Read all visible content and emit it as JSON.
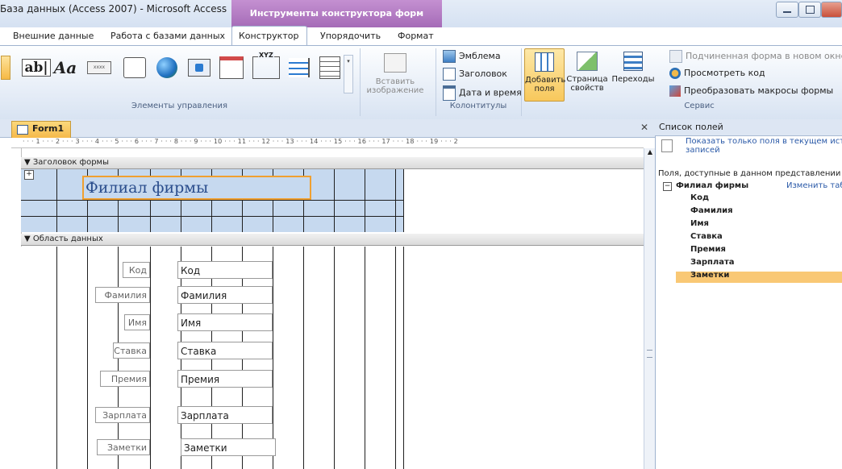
{
  "window": {
    "title": "База данных (Access 2007)  -  Microsoft Access",
    "context_tab_title": "Инструменты конструктора форм"
  },
  "tabs": [
    "Внешние данные",
    "Работа с базами данных",
    "Конструктор",
    "Упорядочить",
    "Формат"
  ],
  "ribbon": {
    "controls_group_label": "Элементы управления",
    "insert_image": [
      "Вставить",
      "изображение"
    ],
    "header_footer": {
      "label": "Колонтитулы",
      "items": [
        "Эмблема",
        "Заголовок",
        "Дата и время"
      ]
    },
    "add_fields": [
      "Добавить",
      "поля"
    ],
    "property_sheet": [
      "Страница",
      "свойств"
    ],
    "transitions": "Переходы",
    "service": {
      "label": "Сервис",
      "items": [
        "Подчиненная форма в новом окне",
        "Просмотреть код",
        "Преобразовать макросы формы"
      ]
    },
    "label_sample": "Aa",
    "textbox_sample": "ab|",
    "xyz": "XYZ"
  },
  "document": {
    "tab_label": "Form1",
    "header_bar": "Заголовок формы",
    "detail_bar": "Область данных",
    "form_title": "Филиал фирмы",
    "fields": [
      {
        "label": "Код",
        "value": "Код"
      },
      {
        "label": "Фамилия",
        "value": "Фамилия"
      },
      {
        "label": "Имя",
        "value": "Имя"
      },
      {
        "label": "Ставка",
        "value": "Ставка"
      },
      {
        "label": "Премия",
        "value": "Премия"
      },
      {
        "label": "Зарплата",
        "value": "Зарплата"
      },
      {
        "label": "Заметки",
        "value": "Заметки"
      }
    ],
    "ruler_marks": "· · · 1 · · · 2 · · · 3 · · · 4 · · · 5 · · · 6 · · · 7 · · · 8 · · · 9 · · · 10 · · · 11 · · · 12 · · · 13 · · · 14 · · · 15 · · · 16 · · · 17 · · · 18 · · · 19 · · · 2"
  },
  "field_list": {
    "title": "Список полей",
    "show_only": [
      "Показать только поля в текущем исто",
      "записей"
    ],
    "available_label": "Поля, доступные в данном представлении",
    "table_name": "Филиал фирмы",
    "edit_link": "Изменить таб",
    "fields": [
      "Код",
      "Фамилия",
      "Имя",
      "Ставка",
      "Премия",
      "Зарплата",
      "Заметки"
    ],
    "selected_field": "Заметки"
  },
  "colors": {
    "context_accent": "#a56bb7",
    "selection_highlight": "#fbd97c",
    "form_header_bg": "#c6d9ef"
  }
}
